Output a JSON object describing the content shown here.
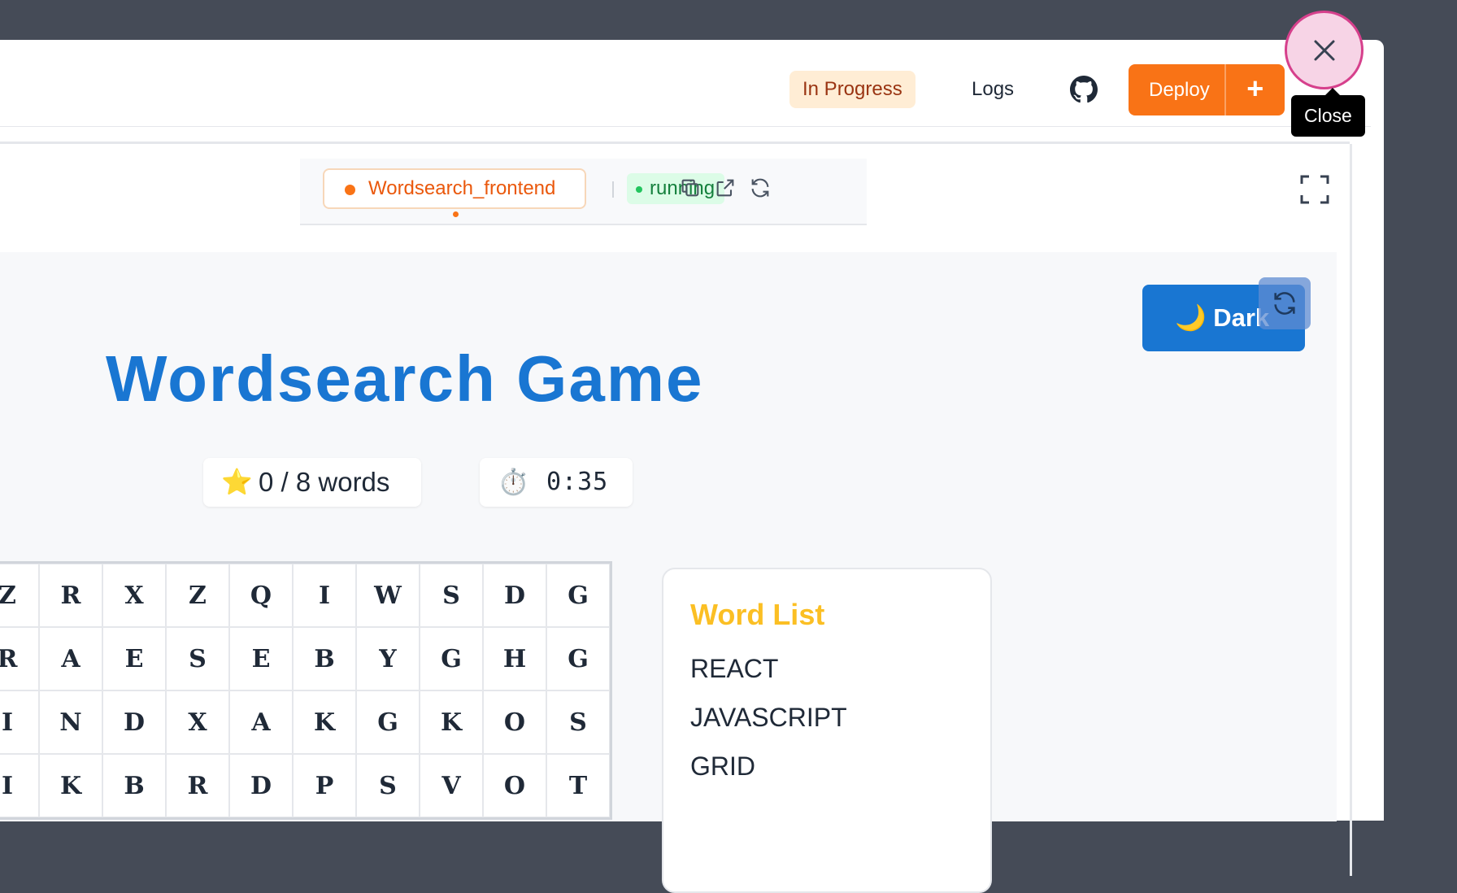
{
  "header": {
    "status": "In Progress",
    "logs_label": "Logs",
    "deploy_label": "Deploy",
    "plus_label": "+",
    "close_tooltip": "Close"
  },
  "toolbar": {
    "service_name": "Wordsearch_frontend",
    "service_status": "running",
    "icons": [
      "copy-icon",
      "external-link-icon",
      "refresh-icon"
    ]
  },
  "app": {
    "theme_button": "🌙 Dark",
    "title": "Wordsearch Game",
    "score_emoji": "⭐",
    "score": "0 / 8 words",
    "timer_emoji": "⏱️",
    "timer": "0:35",
    "grid": [
      [
        "Z",
        "R",
        "X",
        "Z",
        "Q",
        "I",
        "W",
        "S",
        "D",
        "G"
      ],
      [
        "R",
        "A",
        "E",
        "S",
        "E",
        "B",
        "Y",
        "G",
        "H",
        "G"
      ],
      [
        "I",
        "N",
        "D",
        "X",
        "A",
        "K",
        "G",
        "K",
        "O",
        "S"
      ],
      [
        "I",
        "K",
        "B",
        "R",
        "D",
        "P",
        "S",
        "V",
        "O",
        "T"
      ]
    ],
    "word_list_title": "Word List",
    "words": [
      "REACT",
      "JAVASCRIPT",
      "GRID"
    ]
  },
  "colors": {
    "accent_orange": "#f97316",
    "title_blue": "#1976d2",
    "word_list_title": "#fbbf24",
    "running_green": "#15803d"
  }
}
